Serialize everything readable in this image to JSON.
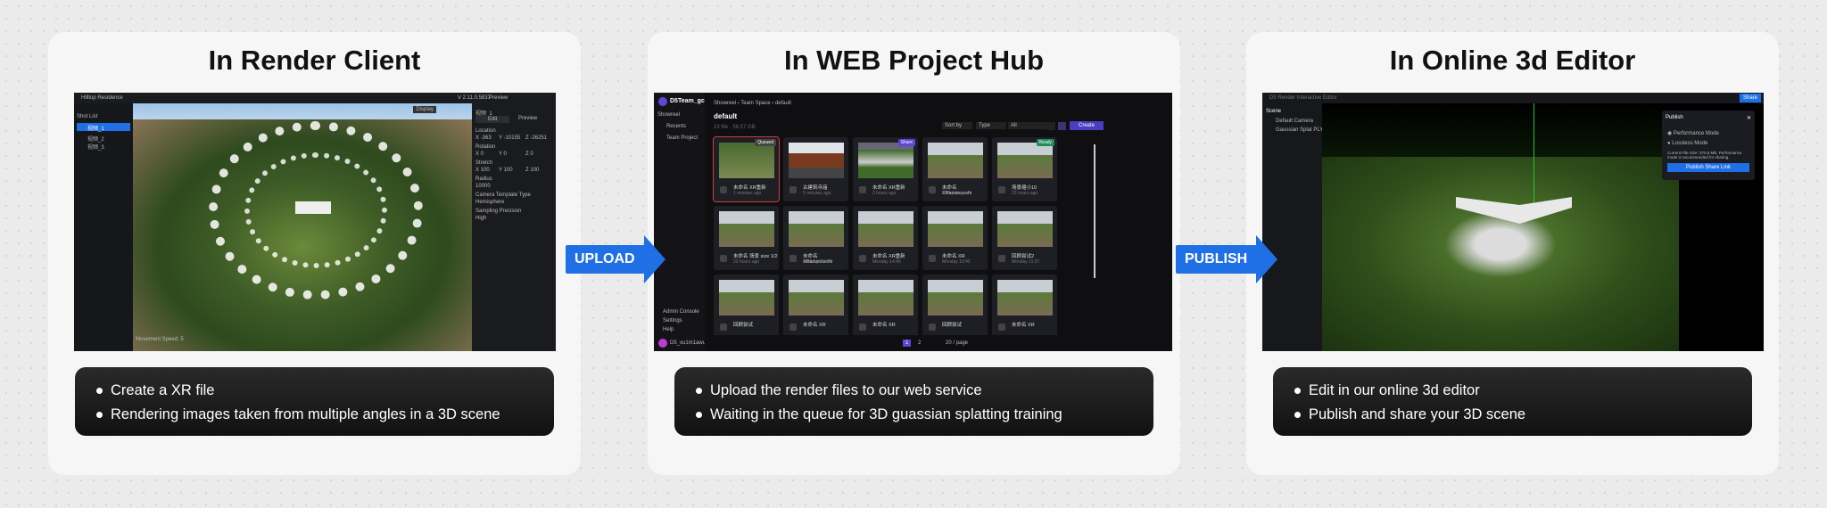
{
  "panels": [
    {
      "title": "In Render Client",
      "bullets": [
        "Create a XR file",
        "Rendering images taken from multiple angles in a 3D scene"
      ]
    },
    {
      "title": "In WEB Project Hub",
      "bullets": [
        "Upload the render files to our web service",
        "Waiting in the queue for 3D guassian splatting training"
      ]
    },
    {
      "title": "In Online 3d Editor",
      "bullets": [
        "Edit in our online 3d editor",
        "Publish and share your 3D scene"
      ]
    }
  ],
  "arrows": {
    "upload": "UPLOAD",
    "publish": "PUBLISH"
  },
  "client": {
    "window_title": "Hilltop Residence",
    "version": "V 2.11.0.5837",
    "preview": "Preview",
    "shot_list": "Shot List",
    "shots": [
      "视频_1",
      "视频_2",
      "视频_3"
    ],
    "shot_name": "视频_1",
    "tabs": [
      "Edit",
      "Preview"
    ],
    "display": "Display",
    "location_label": "Location",
    "location": [
      "X -363",
      "Y -10155",
      "Z -26251"
    ],
    "rotation_label": "Rotation",
    "rotation": [
      "X 0",
      "Y 0",
      "Z 0"
    ],
    "stretch_label": "Stretch",
    "stretch": [
      "X 100",
      "Y 100",
      "Z 100"
    ],
    "radius_label": "Radius",
    "radius": "10000",
    "template_label": "Camera Template Type",
    "template": "Hemisphere",
    "precision_label": "Sampling Precision",
    "precision": "High",
    "speed": "Movement Speed: 5"
  },
  "hub": {
    "team": "D5Team_gc...",
    "showreel": "Showreel",
    "nav": [
      "Recents",
      "Team Project"
    ],
    "bottom_nav": [
      "Admin Console",
      "Settings",
      "Help"
    ],
    "user": "D5_xu1m1awuh...",
    "breadcrumb": [
      "Showreel",
      "Team Space",
      "default"
    ],
    "title": "default",
    "meta": "23 file · 56.57 GB",
    "sort": "Sort by",
    "type": "Type",
    "filter": "All",
    "create": "Create",
    "cards": [
      {
        "name": "未命名 XR重新",
        "time": "1 minutes ago",
        "badge": "Queued"
      },
      {
        "name": "古建筑寺庙",
        "time": "5 minutes ago"
      },
      {
        "name": "未命名 XR重新",
        "time": "2 hours ago",
        "badge": "Share"
      },
      {
        "name": "未命名 XRtuixinceshi",
        "time": "4 hours ago"
      },
      {
        "name": "场景缩小10",
        "time": "23 hours ago",
        "badge": "Ready"
      },
      {
        "name": "未命名 场景 size 1/2",
        "time": "22 hours ago"
      },
      {
        "name": "未命名 XRtuixinceshi",
        "time": "Monday 10:06"
      },
      {
        "name": "未命名 XR重新",
        "time": "Monday 14:40"
      },
      {
        "name": "未命名 XR",
        "time": "Monday 10:45"
      },
      {
        "name": "回顾尝试2",
        "time": "Monday 11:37"
      },
      {
        "name": "回顾尝试",
        "time": ""
      },
      {
        "name": "未命名 XR",
        "time": ""
      },
      {
        "name": "未命名 XR",
        "time": ""
      },
      {
        "name": "回顾尝试",
        "time": ""
      },
      {
        "name": "未命名 XR",
        "time": ""
      }
    ],
    "pages": [
      "1",
      "2"
    ],
    "per_page": "20 / page"
  },
  "editor": {
    "window_title": "D5 Render Interactive Editor",
    "share": "Share",
    "scene": "Scene",
    "items": [
      "Default Camera",
      "Gaussian Splat PLY"
    ],
    "publish_title": "Publish",
    "modes": [
      "Performance Mode",
      "Lossless Mode"
    ],
    "note": "Current File Size: 370.5 MB, Performance mode is recommended for sharing.",
    "publish_btn": "Publish Share Link"
  }
}
